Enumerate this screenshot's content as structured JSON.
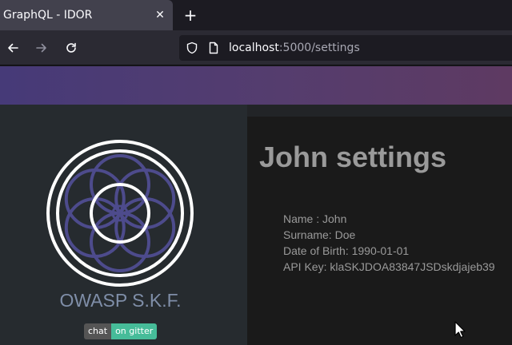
{
  "browser": {
    "tab_title": "GraphQL - IDOR",
    "tab_close": "✕",
    "new_tab": "+",
    "url_host": "localhost",
    "url_path": ":5000/settings"
  },
  "sidebar": {
    "brand": "OWASP S.K.F.",
    "badge_left": "chat",
    "badge_right": "on gitter"
  },
  "main": {
    "title": "John settings",
    "fields": [
      "Name : John",
      "Surname: Doe",
      "Date of Birth: 1990-01-01",
      "API Key: klaSKJDOA83847JSDskdjajeb39"
    ]
  },
  "colors": {
    "logo_white": "#ffffff",
    "logo_purple": "#4d4b8c",
    "brand_text": "#7f8ea8",
    "badge_green": "#46bc99"
  },
  "icons": [
    "back-arrow-icon",
    "forward-arrow-icon",
    "reload-icon",
    "shield-icon",
    "page-icon",
    "close-icon",
    "plus-icon",
    "cursor-icon"
  ]
}
